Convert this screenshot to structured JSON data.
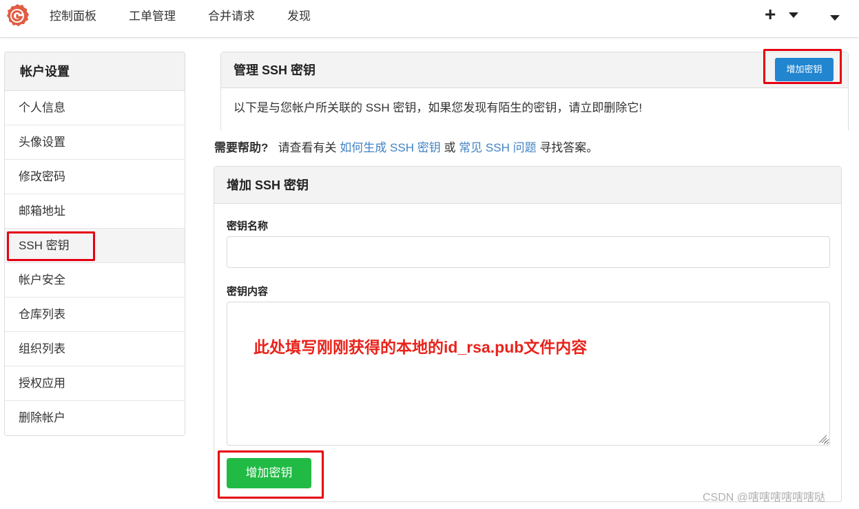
{
  "nav": {
    "items": [
      "控制面板",
      "工单管理",
      "合并请求",
      "发现"
    ],
    "plus": "+"
  },
  "sidebar": {
    "title": "帐户设置",
    "items": [
      {
        "label": "个人信息"
      },
      {
        "label": "头像设置"
      },
      {
        "label": "修改密码"
      },
      {
        "label": "邮箱地址"
      },
      {
        "label": "SSH 密钥",
        "active": true
      },
      {
        "label": "帐户安全"
      },
      {
        "label": "仓库列表"
      },
      {
        "label": "组织列表"
      },
      {
        "label": "授权应用"
      },
      {
        "label": "删除帐户"
      }
    ]
  },
  "manage": {
    "title": "管理 SSH 密钥",
    "add_button": "增加密钥",
    "description": "以下是与您帐户所关联的 SSH 密钥，如果您发现有陌生的密钥，请立即删除它!"
  },
  "help": {
    "label": "需要帮助?",
    "text_before": "请查看有关",
    "link1": "如何生成 SSH 密钥",
    "text_mid": "或",
    "link2": "常见 SSH 问题",
    "text_after": "寻找答案。"
  },
  "add_form": {
    "title": "增加 SSH 密钥",
    "name_label": "密钥名称",
    "name_value": "",
    "content_label": "密钥内容",
    "content_value": "",
    "annotation": "此处填写刚刚获得的本地的id_rsa.pub文件内容",
    "submit": "增加密钥"
  },
  "watermark": "CSDN @嗐嗐嗐嗐嗐嗐哒",
  "colors": {
    "primary": "#2185d0",
    "success": "#21ba45",
    "link": "#4183c4",
    "annotation_red": "#e60012",
    "logo": "#e05d44"
  }
}
